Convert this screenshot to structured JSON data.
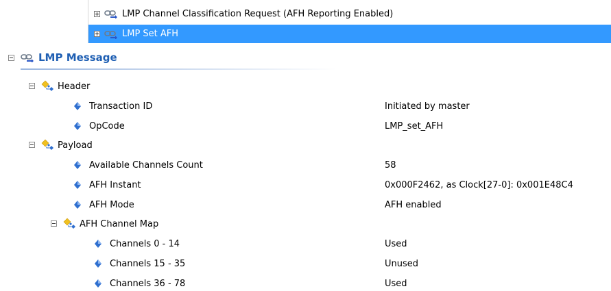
{
  "list": {
    "items": [
      {
        "label": "LMP Channel Classification Request (AFH Reporting Enabled)",
        "selected": false
      },
      {
        "label": "LMP Set AFH",
        "selected": true
      }
    ]
  },
  "message": {
    "title": "LMP Message",
    "header": {
      "label": "Header",
      "fields": [
        {
          "name": "Transaction ID",
          "value": "Initiated by master"
        },
        {
          "name": "OpCode",
          "value": "LMP_set_AFH"
        }
      ]
    },
    "payload": {
      "label": "Payload",
      "fields": [
        {
          "name": "Available Channels Count",
          "value": "58"
        },
        {
          "name": "AFH Instant",
          "value": "0x000F2462, as Clock[27-0]: 0x001E48C4"
        },
        {
          "name": "AFH Mode",
          "value": "AFH enabled"
        }
      ],
      "channel_map": {
        "label": "AFH Channel Map",
        "fields": [
          {
            "name": "Channels 0 - 14",
            "value": "Used"
          },
          {
            "name": "Channels 15 - 35",
            "value": "Unused"
          },
          {
            "name": "Channels 36 - 78",
            "value": "Used"
          }
        ]
      }
    }
  },
  "colors": {
    "selection": "#3399ff",
    "title": "#1f5fb3",
    "field_icon": "#2f6fcf",
    "struct_icon": "#f0c020"
  }
}
